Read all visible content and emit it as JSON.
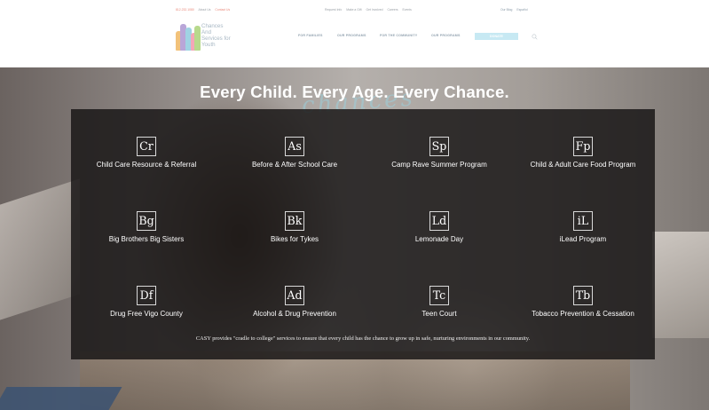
{
  "topbar": {
    "phone_label": "812.232.1080",
    "links_left": [
      "About Us",
      "Contact Us"
    ],
    "links_mid": [
      "Request Info",
      "Make a Gift",
      "Get Involved",
      "Careers",
      "Events"
    ],
    "links_right": [
      "Our Blog",
      "Español"
    ]
  },
  "logo": {
    "line1": "Chances",
    "line2": "And",
    "line3": "Services for",
    "line4": "Youth"
  },
  "nav": {
    "items": [
      "FOR FAMILIES",
      "OUR PROGRAMS",
      "FOR THE COMMUNITY",
      "OUR PROGRAMS"
    ],
    "donate_label": "DONATE"
  },
  "hero": {
    "title": "Every Child. Every Age. Every Chance.",
    "script_word": "chances"
  },
  "programs": [
    {
      "symbol": "Cr",
      "label": "Child Care Resource & Referral"
    },
    {
      "symbol": "As",
      "label": "Before & After School Care"
    },
    {
      "symbol": "Sp",
      "label": "Camp Rave Summer Program"
    },
    {
      "symbol": "Fp",
      "label": "Child & Adult Care Food Program"
    },
    {
      "symbol": "Bg",
      "label": "Big Brothers Big Sisters"
    },
    {
      "symbol": "Bk",
      "label": "Bikes for Tykes"
    },
    {
      "symbol": "Ld",
      "label": "Lemonade Day"
    },
    {
      "symbol": "iL",
      "label": "iLead Program"
    },
    {
      "symbol": "Df",
      "label": "Drug Free Vigo County"
    },
    {
      "symbol": "Ad",
      "label": "Alcohol & Drug Prevention"
    },
    {
      "symbol": "Tc",
      "label": "Teen Court"
    },
    {
      "symbol": "Tb",
      "label": "Tobacco Prevention & Cessation"
    }
  ],
  "panel_description": "CASY provides \"cradle to college\" services to ensure that every child has the chance to grow up in safe, nurturing environments in our community.",
  "colors": {
    "panel_bg": "#181616",
    "donate_bg": "#c7e9f3",
    "nav_text": "#93a3b0",
    "accent_red": "#e9897b"
  },
  "icons": {
    "search": "search-icon",
    "logo_figures": "children-figures-icon"
  }
}
